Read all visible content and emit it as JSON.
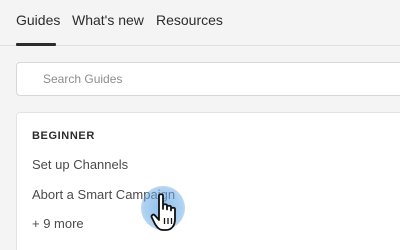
{
  "tabs": [
    {
      "label": "Guides",
      "active": true
    },
    {
      "label": "What's new",
      "active": false
    },
    {
      "label": "Resources",
      "active": false
    }
  ],
  "search": {
    "placeholder": "Search Guides",
    "value": ""
  },
  "card": {
    "heading": "BEGINNER",
    "items": [
      {
        "label": "Set up Channels"
      },
      {
        "label": "Abort a Smart Campaign"
      }
    ],
    "more_label": "+ 9 more"
  },
  "cursor": {
    "icon": "hand-pointer-icon",
    "highlight_color": "#6aaae6"
  }
}
